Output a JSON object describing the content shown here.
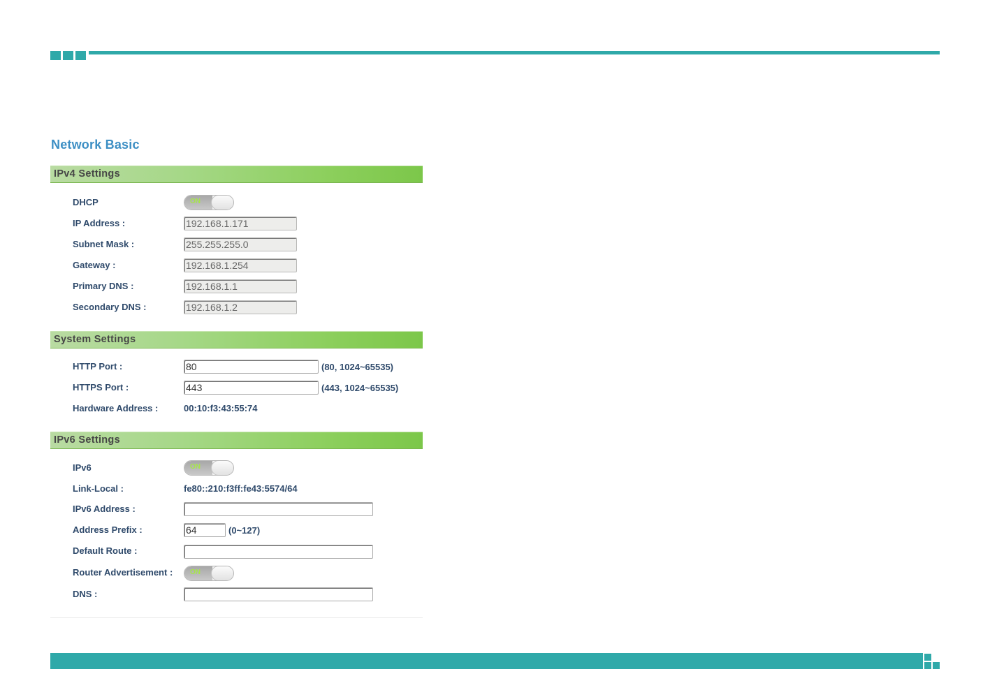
{
  "page_title": "Network Basic",
  "sections": {
    "ipv4": {
      "header": "IPv4 Settings",
      "dhcp": {
        "label": "DHCP",
        "toggle_text": "ON"
      },
      "ip_address": {
        "label": "IP Address :",
        "value": "192.168.1.171"
      },
      "subnet_mask": {
        "label": "Subnet Mask :",
        "value": "255.255.255.0"
      },
      "gateway": {
        "label": "Gateway :",
        "value": "192.168.1.254"
      },
      "primary_dns": {
        "label": "Primary DNS :",
        "value": "192.168.1.1"
      },
      "secondary_dns": {
        "label": "Secondary DNS :",
        "value": "192.168.1.2"
      }
    },
    "system": {
      "header": "System Settings",
      "http_port": {
        "label": "HTTP Port :",
        "value": "80",
        "hint": "(80, 1024~65535)"
      },
      "https_port": {
        "label": "HTTPS Port :",
        "value": "443",
        "hint": "(443, 1024~65535)"
      },
      "hardware_address": {
        "label": "Hardware Address :",
        "value": "00:10:f3:43:55:74"
      }
    },
    "ipv6": {
      "header": "IPv6 Settings",
      "ipv6": {
        "label": "IPv6",
        "toggle_text": "ON"
      },
      "link_local": {
        "label": "Link-Local :",
        "value": "fe80::210:f3ff:fe43:5574/64"
      },
      "ipv6_address": {
        "label": "IPv6 Address :",
        "value": ""
      },
      "address_prefix": {
        "label": "Address Prefix :",
        "value": "64",
        "hint": "(0~127)"
      },
      "default_route": {
        "label": "Default Route :",
        "value": ""
      },
      "router_advertisement": {
        "label": "Router Advertisement :",
        "toggle_text": "ON"
      },
      "dns": {
        "label": "DNS :",
        "value": ""
      }
    }
  },
  "colors": {
    "accent_teal": "#2fa9a9",
    "title_blue": "#3d8fc4",
    "label_navy": "#2f4a6b",
    "header_green": "#8ccf5c"
  }
}
